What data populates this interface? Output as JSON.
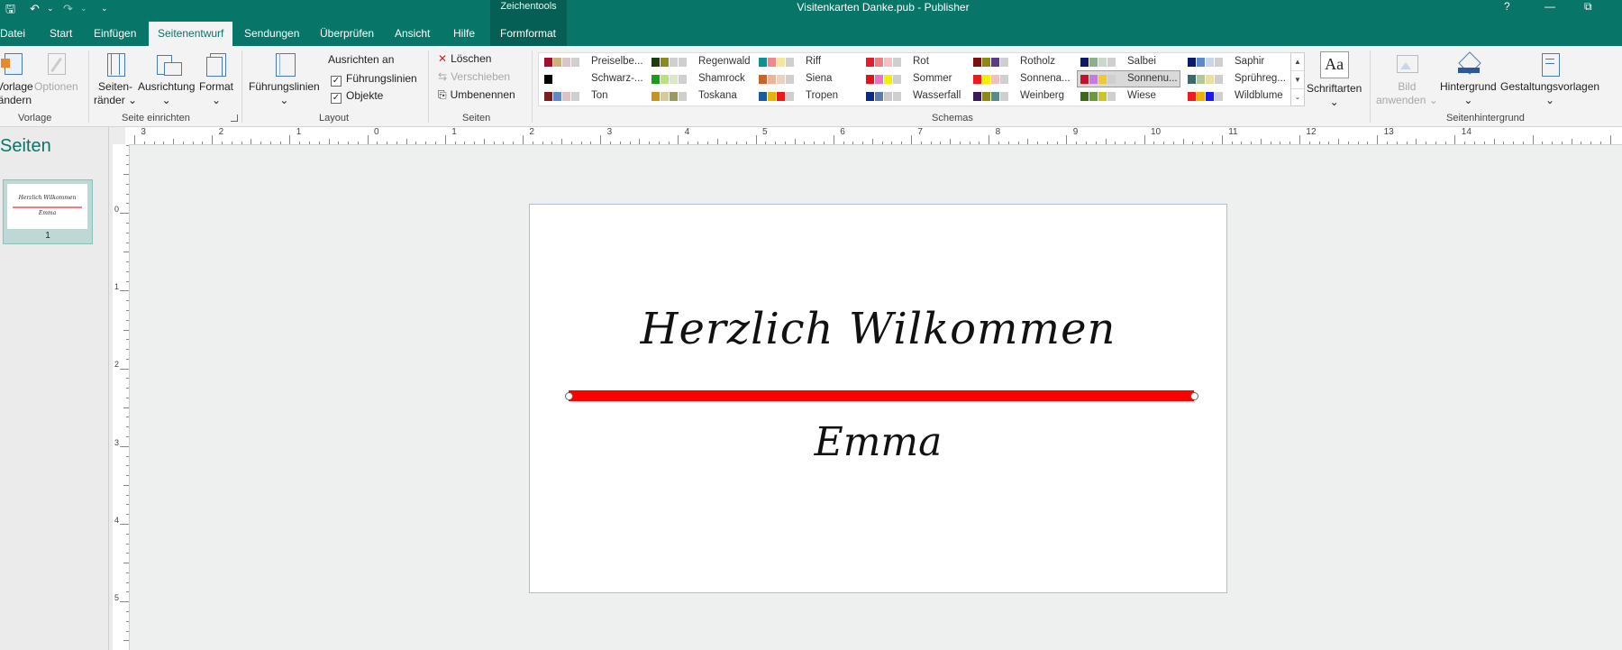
{
  "window": {
    "title": "Visitenkarten Danke.pub  -  Publisher",
    "help": "?",
    "minimize": "—",
    "restore": "⧉"
  },
  "qat": {
    "save": "🖫",
    "undo": "↶",
    "redo": "↷",
    "more": "⌄"
  },
  "context_tab": "Zeichentools",
  "tabs": [
    "Datei",
    "Start",
    "Einfügen",
    "Seitenentwurf",
    "Sendungen",
    "Überprüfen",
    "Ansicht",
    "Hilfe",
    "Formformat"
  ],
  "ribbon": {
    "vorlage": {
      "btn1": "Vorlage",
      "btn1b": "ändern",
      "btn2": "Optionen",
      "label": "Vorlage"
    },
    "seite": {
      "seitenraender": "Seiten-",
      "seitenraender2": "ränder ⌄",
      "ausrichtung": "Ausrichtung",
      "ausrichtung2": "⌄",
      "format": "Format",
      "format2": "⌄",
      "label": "Seite einrichten"
    },
    "layout": {
      "fuehrungslinien": "Führungslinien",
      "fuehrungslinien2": "⌄",
      "ausrichten_an": "Ausrichten an",
      "chk1": "Führungslinien",
      "chk2": "Objekte",
      "label": "Layout"
    },
    "seiten": {
      "loeschen": "Löschen",
      "verschieben": "Verschieben",
      "umbenennen": "Umbenennen",
      "label": "Seiten"
    },
    "schemas": {
      "label": "Schemas",
      "items": [
        {
          "name": "Preiselbe...",
          "colors": [
            "#a50f2d",
            "#c9b37a",
            "#d9c7c7",
            "#cfcfcf"
          ]
        },
        {
          "name": "Schwarz-...",
          "colors": [
            "#000000",
            "#ffffff",
            "#ffffff",
            "#ffffff"
          ]
        },
        {
          "name": "Ton",
          "colors": [
            "#7a1f1f",
            "#5b8bc8",
            "#dcc3c3",
            "#cfcfcf"
          ]
        },
        {
          "name": "Regenwald",
          "colors": [
            "#1f3d0c",
            "#8a8a1a",
            "#cfcfcf",
            "#cfcfcf"
          ]
        },
        {
          "name": "Shamrock",
          "colors": [
            "#1c9c1c",
            "#b9e37a",
            "#dbe9c9",
            "#cfcfcf"
          ]
        },
        {
          "name": "Toskana",
          "colors": [
            "#c89518",
            "#d8c99a",
            "#9a9a5a",
            "#cfcfcf"
          ]
        },
        {
          "name": "Riff",
          "colors": [
            "#0f8f8f",
            "#f08a8a",
            "#f2e6a0",
            "#cfcfcf"
          ]
        },
        {
          "name": "Siena",
          "colors": [
            "#c8642a",
            "#e8b49a",
            "#e8d2c2",
            "#cfcfcf"
          ]
        },
        {
          "name": "Tropen",
          "colors": [
            "#1a5aa0",
            "#e8b400",
            "#e81a1a",
            "#cfcfcf"
          ]
        },
        {
          "name": "Rot",
          "colors": [
            "#e81a2a",
            "#f08080",
            "#f5c0c0",
            "#cfcfcf"
          ]
        },
        {
          "name": "Sommer",
          "colors": [
            "#e8101a",
            "#f070c0",
            "#f0f000",
            "#cfcfcf"
          ]
        },
        {
          "name": "Wasserfall",
          "colors": [
            "#0a2a8a",
            "#5a7ab0",
            "#c9c9c9",
            "#cfcfcf"
          ]
        },
        {
          "name": "Rotholz",
          "colors": [
            "#7a1010",
            "#8a8a1a",
            "#5a3a8a",
            "#cfcfcf"
          ]
        },
        {
          "name": "Sonnena...",
          "colors": [
            "#f01a1a",
            "#f0f000",
            "#f0c0c0",
            "#cfcfcf"
          ]
        },
        {
          "name": "Weinberg",
          "colors": [
            "#3a1a5a",
            "#8a8a1a",
            "#5a8a8a",
            "#cfcfcf"
          ]
        },
        {
          "name": "Salbei",
          "colors": [
            "#0a1a6a",
            "#8ab08a",
            "#c9d9c9",
            "#cfcfcf"
          ]
        },
        {
          "name": "Sonnenu...",
          "colors": [
            "#c8102a",
            "#c878e0",
            "#f0c830",
            "#cfcfcf"
          ]
        },
        {
          "name": "Wiese",
          "colors": [
            "#3a6a1a",
            "#6a9a3a",
            "#c8c820",
            "#cfcfcf"
          ]
        },
        {
          "name": "Saphir",
          "colors": [
            "#0a1a6a",
            "#5a8ac8",
            "#c9d5e9",
            "#cfcfcf"
          ]
        },
        {
          "name": "Sprühreg...",
          "colors": [
            "#3a6a6a",
            "#b0c89a",
            "#e8e0a0",
            "#cfcfcf"
          ]
        },
        {
          "name": "Wildblume",
          "colors": [
            "#f01a1a",
            "#f0b000",
            "#1a1af0",
            "#cfcfcf"
          ]
        }
      ],
      "selected": "Sonnenu..."
    },
    "schriftarten": {
      "label": "Schriftarten",
      "arrow": "⌄",
      "glyph": "Aa"
    },
    "hintergrund": {
      "bild": "Bild",
      "bild2": "anwenden ⌄",
      "hintergrund": "Hintergrund",
      "hintergrund2": "⌄",
      "gestaltung": "Gestaltungsvorlagen",
      "gestaltung2": "⌄",
      "label": "Seitenhintergrund"
    }
  },
  "ruler_h": [
    "5",
    "4",
    "3",
    "2",
    "1",
    "0",
    "1",
    "2",
    "3",
    "4",
    "5",
    "6",
    "7",
    "8",
    "9",
    "10",
    "11",
    "12",
    "13",
    "14"
  ],
  "ruler_v": [
    "0",
    "1",
    "2",
    "3",
    "4",
    "5"
  ],
  "pages_panel": {
    "title": "Seiten",
    "page_number": "1",
    "thumb_heading": "Herzlich Wilkommen",
    "thumb_name": "Emma"
  },
  "document": {
    "heading": "Herzlich Wilkommen",
    "name": "Emma",
    "line_color": "#ff0000"
  }
}
